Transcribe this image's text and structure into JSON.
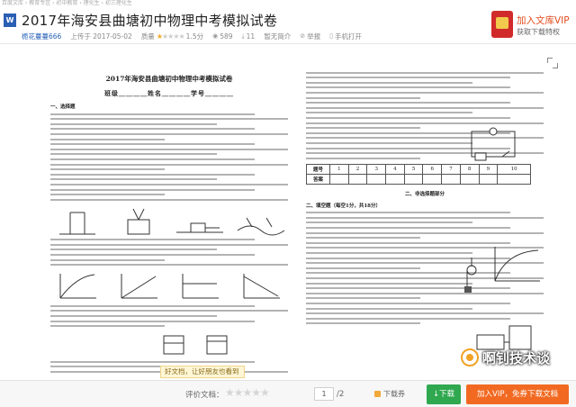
{
  "breadcrumb": "百度文库 › 教育专区 › 初中教育 › 理化生 › 初三理化生",
  "document": {
    "title": "2017年海安县曲塘初中物理中考模拟试卷"
  },
  "meta": {
    "uploader": "栀花蔓蔓666",
    "upload_date": "上传于 2017-05-02",
    "quality_label": "质量",
    "rating": 1.5,
    "rating_text": "1.5分",
    "views": "589",
    "downloads": "11",
    "intro": "暂无简介",
    "report": "举报",
    "mobile_open": "手机打开"
  },
  "vip_promo": {
    "title": "加入文库VIP",
    "subtitle": "获取下载特权",
    "color": "#e24d1e"
  },
  "doc_page": {
    "heading": "2017年海安县曲塘初中物理中考模拟试卷",
    "fields": "班级＿＿＿＿姓名＿＿＿＿学号＿＿＿＿",
    "section1": "一、选择题",
    "section2_title": "二、非选择题部分",
    "answer_table": {
      "header_label": "题号",
      "answer_label": "答案",
      "numbers": [
        "1",
        "2",
        "3",
        "4",
        "5",
        "6",
        "7",
        "8",
        "9",
        "10"
      ]
    },
    "fill_section": "二、填空题（每空1分，共18分）"
  },
  "share_banner": "好文档，让好朋友也看到",
  "watermark": "啊钊技术谈",
  "footer": {
    "rate_label": "评价文档：",
    "page_current": "1",
    "page_total": "/2",
    "download_link": "下载券",
    "download_button": "↓下载",
    "vip_button": "加入VIP，免券下载文档",
    "download_color": "#2fa84f",
    "vip_color": "#f26a22"
  }
}
